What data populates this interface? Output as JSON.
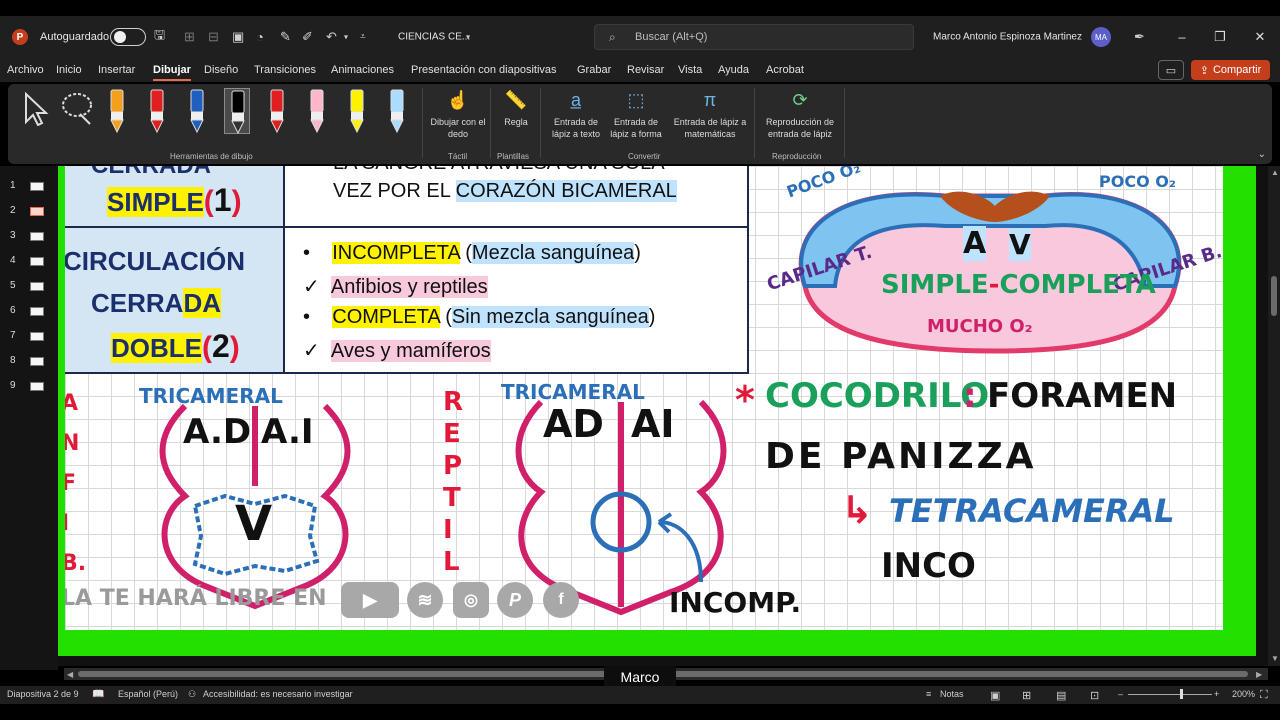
{
  "titlebar": {
    "autosave_label": "Autoguardado",
    "document_title": "CIENCIAS CE...",
    "search_placeholder": "Buscar (Alt+Q)",
    "user_name": "Marco Antonio Espinoza Martinez",
    "avatar_initials": "MA"
  },
  "menu": {
    "items": [
      "Archivo",
      "Inicio",
      "Insertar",
      "Dibujar",
      "Diseño",
      "Transiciones",
      "Animaciones",
      "Presentación con diapositivas",
      "Grabar",
      "Revisar",
      "Vista",
      "Ayuda",
      "Acrobat"
    ],
    "active": "Dibujar",
    "share_label": "Compartir"
  },
  "ribbon": {
    "groups": {
      "drawing_tools": "Herramientas de dibujo",
      "touch": "Táctil",
      "stencils": "Plantillas",
      "convert": "Convertir",
      "replay": "Reproducción"
    },
    "buttons": {
      "draw_with_finger": "Dibujar con el dedo",
      "ruler": "Regla",
      "ink_to_text": "Entrada de lápiz a texto",
      "ink_to_shape": "Entrada de lápiz a forma",
      "ink_to_math": "Entrada de lápiz a matemáticas",
      "ink_replay": "Reproducción de entrada de lápiz"
    },
    "pen_colors": [
      "#f4a01c",
      "#e02020",
      "#1f5fbf",
      "#000000",
      "#e02020",
      "#ffb6c8",
      "#fff200",
      "#a9dcff"
    ]
  },
  "thumbnails": [
    "1",
    "2",
    "3",
    "4",
    "5",
    "6",
    "7",
    "8",
    "9"
  ],
  "active_slide": "2",
  "slide": {
    "row1": {
      "left_top_partial": "CERRADA",
      "left_label": "SIMPLE",
      "left_num": "1",
      "right_line1_partial": "LA SANGRE ATRAVIESA UNA SOLA",
      "right_line2_pre": "VEZ POR EL ",
      "right_line2_hl": "CORAZÓN BICAMERAL"
    },
    "row2": {
      "left_line1": "CIRCULACIÓN",
      "left_line2_a": "CERRA",
      "left_line2_b": "DA",
      "left_line3_a": "DOBLE",
      "left_num": "2",
      "b1_hl": "INCOMPLETA",
      "b1_rest_open": " (",
      "b1_hl2": "Mezcla sanguínea",
      "b1_close": ")",
      "b2": "Anfibios y reptiles",
      "b3_hl": "COMPLETA",
      "b3_rest_open": " (",
      "b3_hl2": "Sin mezcla sanguínea",
      "b3_close": ")",
      "b4": "Aves y mamíferos",
      "bullet": "•",
      "check": "✓"
    },
    "diagram_top": {
      "poco_left": "POCO O₂",
      "poco_right": "POCO O₂",
      "capilar_left": "CAPILAR T.",
      "capilar_right": "CAPILAR B.",
      "atrium": "A",
      "ventricle": "V",
      "simple": "SIMPLE",
      "dash": "-",
      "completa": "COMPLETA",
      "mucho": "MUCHO O₂"
    },
    "heart_left": {
      "tricameral": "TRICAMERAL",
      "ad": "A.D",
      "ai": "A.I",
      "v": "V",
      "side_letters": "A N F I B."
    },
    "heart_right": {
      "tricameral": "TRICAMERAL",
      "ad": "AD",
      "ai": "AI",
      "incomp": "INCOMP.",
      "reptil": "R E P T I L"
    },
    "note": {
      "asterisk": "*",
      "cocodrilo": "COCODRILO",
      "colon": ":",
      "foramen": "FORAMEN",
      "de_panizza": "DE PANIZZA",
      "arrow": "↳",
      "tetracameral": "TETRACAMERAL",
      "inco": "INCO"
    },
    "footer_text": "LA TE HARÁ LIBRE EN"
  },
  "caption": "Marco",
  "status": {
    "slide_counter": "Diapositiva 2 de 9",
    "language": "Español (Perú)",
    "accessibility": "Accesibilidad: es necesario investigar",
    "notes": "Notas",
    "zoom": "200%",
    "zoom_level": 0.62
  }
}
